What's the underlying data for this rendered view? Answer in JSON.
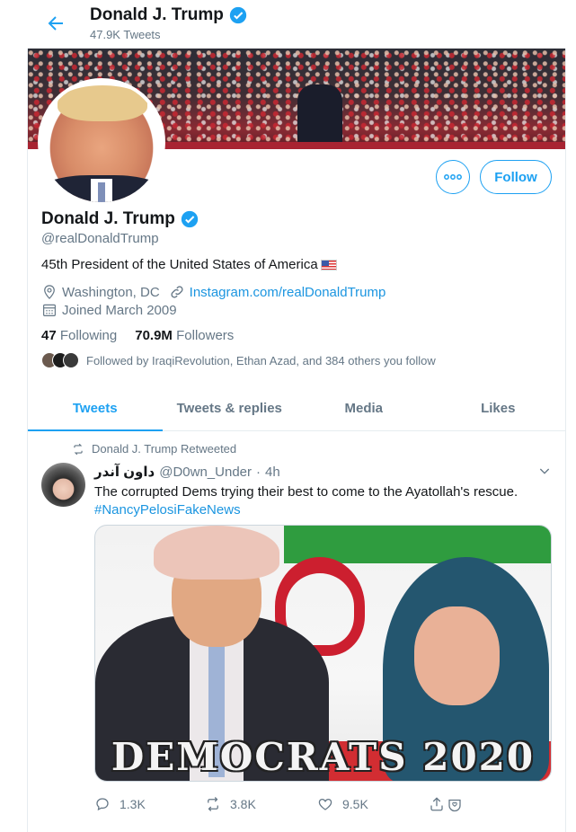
{
  "header": {
    "name": "Donald J. Trump",
    "tweet_count": "47.9K Tweets"
  },
  "profile": {
    "name": "Donald J. Trump",
    "handle": "@realDonaldTrump",
    "bio": "45th President of the United States of America",
    "location": "Washington, DC",
    "link": "Instagram.com/realDonaldTrump",
    "joined": "Joined March 2009",
    "following_count": "47",
    "following_label": "Following",
    "followers_count": "70.9M",
    "followers_label": "Followers",
    "followed_by": "Followed by IraqiRevolution, Ethan Azad, and 384 others you follow",
    "follow_label": "Follow"
  },
  "tabs": [
    {
      "label": "Tweets",
      "active": true
    },
    {
      "label": "Tweets & replies",
      "active": false
    },
    {
      "label": "Media",
      "active": false
    },
    {
      "label": "Likes",
      "active": false
    }
  ],
  "tweet": {
    "retweet_note": "Donald J. Trump Retweeted",
    "author_name": "داون آندر",
    "author_handle": "@D0wn_Under",
    "separator": "·",
    "time": "4h",
    "text": "The corrupted Dems trying their best to come to the Ayatollah's rescue.",
    "hashtag": "#NancyPelosiFakeNews",
    "media_caption": "DEMOCRATS 2020",
    "replies": "1.3K",
    "retweets": "3.8K",
    "likes": "9.5K"
  },
  "colors": {
    "accent": "#1da1f2",
    "text": "#14171a",
    "muted": "#657786",
    "border": "#e6ecf0"
  }
}
